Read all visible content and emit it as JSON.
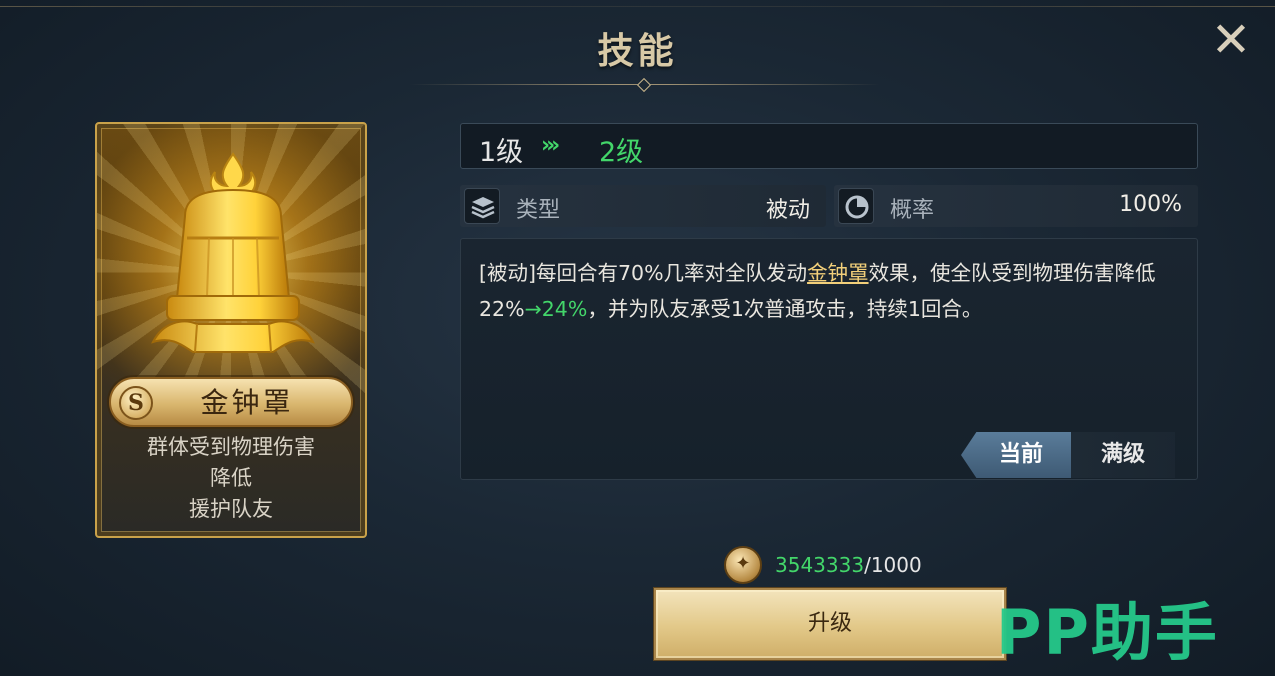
{
  "window": {
    "title": "技能",
    "close_icon": "close-icon"
  },
  "skill_card": {
    "rank": "S",
    "name": "金钟罩",
    "desc_lines": [
      "群体受到物理伤害",
      "降低",
      "援护队友"
    ],
    "icon": "golden-bell-icon"
  },
  "level": {
    "current": "1级",
    "arrows": "›››",
    "next": "2级"
  },
  "info": {
    "type_label": "类型",
    "type_value": "被动",
    "type_icon": "layers-icon",
    "prob_label": "概率",
    "prob_value": "100%",
    "prob_icon": "pie-chart-icon"
  },
  "description": {
    "part1": "[被动]每回合有70%几率对全队发动",
    "highlight": "金钟罩",
    "part2": "效果，使全队受到物理伤害降低22%",
    "arrow_value": "→24%",
    "part3": "，并为队友承受1次普通攻击，持续1回合。"
  },
  "tabs": {
    "current": "当前",
    "max": "满级"
  },
  "cost": {
    "have": "3543333",
    "need": "/1000",
    "icon": "coin-icon"
  },
  "upgrade_button": "升级",
  "watermark": "PP助手",
  "colors": {
    "accent_green": "#43d66a",
    "gold": "#c9a24a",
    "highlight": "#f2cf7a"
  }
}
